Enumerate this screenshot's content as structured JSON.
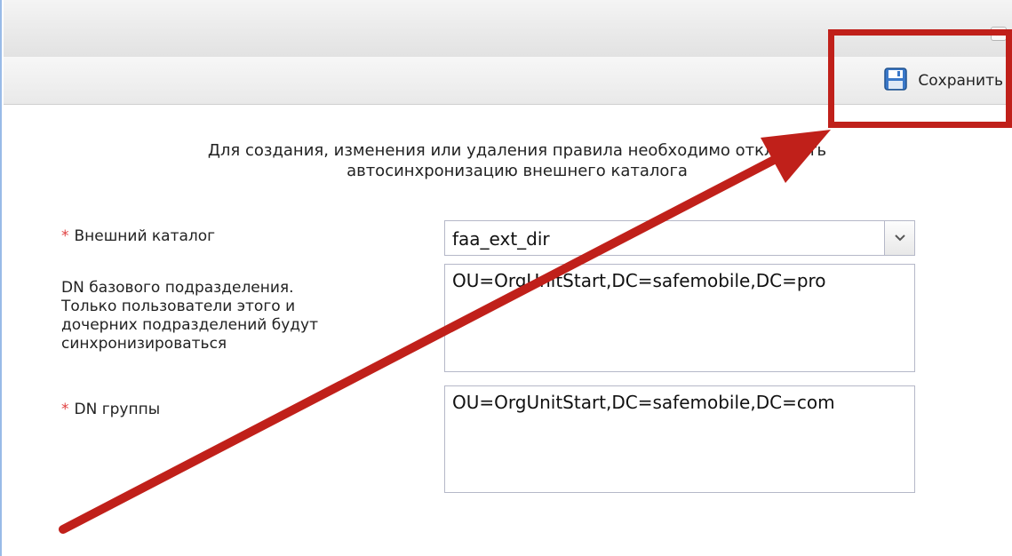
{
  "window": {
    "collapse_glyph": "»"
  },
  "toolbar": {
    "save_label": "Сохранить",
    "save_icon": "floppy-disk-icon"
  },
  "notice": {
    "line1": "Для создания, изменения или удаления правила необходимо отключить",
    "line2": "автосинхронизацию внешнего каталога"
  },
  "form": {
    "external_catalog": {
      "required_mark": "*",
      "label": "Внешний каталог",
      "value": "faa_ext_dir"
    },
    "base_dn": {
      "label_lines": [
        "DN базового подразделения.",
        "Только пользователи этого и",
        "дочерних подразделений будут",
        "синхронизироваться"
      ],
      "value": "OU=OrgUnitStart,DC=safemobile,DC=pro"
    },
    "group_dn": {
      "required_mark": "*",
      "label": "DN группы",
      "value": "OU=OrgUnitStart,DC=safemobile,DC=com"
    }
  },
  "annotation": {
    "color": "#c0201a"
  }
}
